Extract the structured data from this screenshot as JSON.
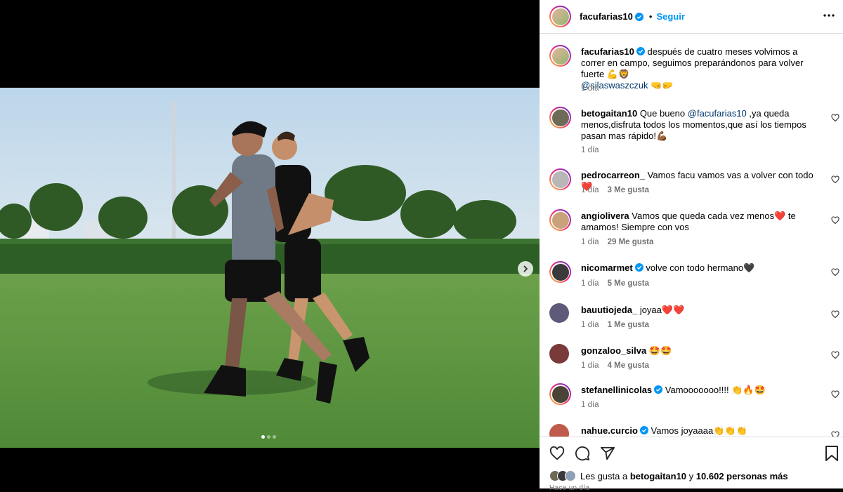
{
  "post": {
    "username": "facufarias10",
    "follow_label": "Seguir",
    "caption_text": "después de cuatro meses volvimos a correr en campo, seguimos preparándonos para volver fuerte 💪🦁",
    "caption_mention": "@silaswaszczuk",
    "caption_emoji": "🤜🤛",
    "caption_time": "1 día"
  },
  "comments": [
    {
      "username": "betogaitan10",
      "verified": false,
      "text_before": "Que bueno ",
      "mention": "@facufarias10",
      "text_after": " ,ya queda menos,disfruta todos los momentos,que así los tiempos pasan mas rápido!💪🏾",
      "time": "1 día",
      "likes": ""
    },
    {
      "username": "pedrocarreon_",
      "verified": false,
      "text_before": "Vamos facu vamos vas a volver con todo ❤️",
      "mention": "",
      "text_after": "",
      "time": "1 día",
      "likes": "3 Me gusta"
    },
    {
      "username": "angiolivera",
      "verified": false,
      "text_before": "Vamos que queda cada vez menos❤️ te amamos! Siempre con vos",
      "mention": "",
      "text_after": "",
      "time": "1 día",
      "likes": "29 Me gusta"
    },
    {
      "username": "nicomarmet",
      "verified": true,
      "text_before": "volve con todo hermano🖤",
      "mention": "",
      "text_after": "",
      "time": "1 día",
      "likes": "5 Me gusta"
    },
    {
      "username": "bauutiojeda_",
      "verified": false,
      "text_before": "joyaa❤️❤️",
      "mention": "",
      "text_after": "",
      "time": "1 día",
      "likes": "1 Me gusta"
    },
    {
      "username": "gonzaloo_silva",
      "verified": false,
      "text_before": "🤩🤩",
      "mention": "",
      "text_after": "",
      "time": "1 día",
      "likes": "4 Me gusta"
    },
    {
      "username": "stefanellinicolas",
      "verified": true,
      "text_before": "Vamooooooo!!!! 👏🔥🤩",
      "mention": "",
      "text_after": "",
      "time": "1 día",
      "likes": ""
    },
    {
      "username": "nahue.curcio",
      "verified": true,
      "text_before": "Vamos joyaaaa👏👏👏",
      "mention": "",
      "text_after": "",
      "time": "",
      "likes": ""
    }
  ],
  "likes_summary": {
    "prefix": "Les gusta a",
    "user": "betogaitan10",
    "joiner": "y",
    "others": "10.602 personas más"
  },
  "post_time": "Hace un día",
  "colors": {
    "accent": "#0095f6",
    "verified": "#0095f6",
    "heart": "#ed4956",
    "meta": "#737373"
  },
  "icons": [
    "more-icon",
    "verified-icon",
    "heart-icon",
    "comment-icon",
    "share-icon",
    "bookmark-icon",
    "chevron-right-icon"
  ]
}
